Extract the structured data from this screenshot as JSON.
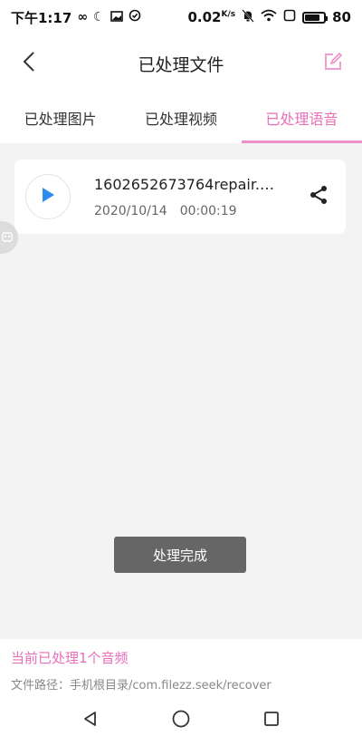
{
  "status_bar": {
    "time": "下午1:17",
    "left_icons": [
      "infinity-icon",
      "moon-icon",
      "image-icon",
      "check-circle-icon"
    ],
    "net_speed": "0.02",
    "net_speed_unit": "K/s",
    "right_icons": [
      "bell-off-icon",
      "wifi-icon",
      "square-icon",
      "battery-icon"
    ],
    "battery_level": "80"
  },
  "header": {
    "title": "已处理文件",
    "back_icon": "chevron-left-icon",
    "edit_icon": "edit-icon",
    "accent_color": "#e96fba"
  },
  "tabs": [
    {
      "label": "已处理图片",
      "active": false
    },
    {
      "label": "已处理视频",
      "active": false
    },
    {
      "label": "已处理语音",
      "active": true
    }
  ],
  "files": [
    {
      "name": "1602652673764repair.m...",
      "date": "2020/10/14",
      "duration": "00:00:19",
      "play_icon": "play-icon",
      "share_icon": "share-icon"
    }
  ],
  "done_button": {
    "label": "处理完成"
  },
  "footer": {
    "summary": "当前已处理1个音频",
    "path": "文件路径：手机根目录/com.filezz.seek/recover"
  },
  "nav": {
    "icons": [
      "back-triangle-icon",
      "home-circle-icon",
      "recents-square-icon"
    ]
  }
}
